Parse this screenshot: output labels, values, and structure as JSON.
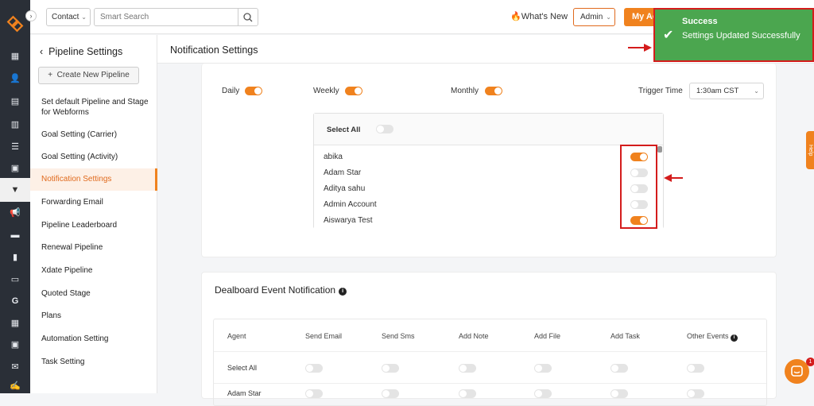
{
  "topbar": {
    "contact_select": "Contact",
    "search_placeholder": "Smart Search",
    "whats_new": "What's New",
    "role_select": "Admin",
    "my_account_btn": "My Ac"
  },
  "sidebar": {
    "back_title": "Pipeline Settings",
    "new_pipeline": "Create New Pipeline",
    "items": [
      "Set default Pipeline and Stage for Webforms",
      "Goal Setting (Carrier)",
      "Goal Setting (Activity)",
      "Notification Settings",
      "Forwarding Email",
      "Pipeline Leaderboard",
      "Renewal Pipeline",
      "Xdate Pipeline",
      "Quoted Stage",
      "Plans",
      "Automation Setting",
      "Task Setting"
    ],
    "active_index": 3
  },
  "page": {
    "title": "Notification Settings"
  },
  "schedule": {
    "daily_label": "Daily",
    "daily_on": true,
    "weekly_label": "Weekly",
    "weekly_on": true,
    "monthly_label": "Monthly",
    "monthly_on": true,
    "trigger_label": "Trigger Time",
    "trigger_value": "1:30am CST"
  },
  "agents": {
    "select_all_label": "Select All",
    "select_all_on": false,
    "list": [
      {
        "name": "abika",
        "on": true
      },
      {
        "name": "Adam Star",
        "on": false
      },
      {
        "name": "Aditya sahu",
        "on": false
      },
      {
        "name": "Admin Account",
        "on": false
      },
      {
        "name": "Aiswarya Test",
        "on": true
      }
    ]
  },
  "dealboard": {
    "title": "Dealboard Event Notification",
    "columns": [
      "Agent",
      "Send Email",
      "Send Sms",
      "Add Note",
      "Add File",
      "Add Task",
      "Other Events"
    ],
    "select_all_label": "Select All",
    "partial_row_label": "Adam Star"
  },
  "toast": {
    "title": "Success",
    "message": "Settings Updated Successfully"
  },
  "help_tab": "Help",
  "chat_badge": "1",
  "colors": {
    "accent": "#f0821e",
    "rail": "#2a2f37",
    "toast": "#4ba64f",
    "annotation": "#d41c1c"
  }
}
